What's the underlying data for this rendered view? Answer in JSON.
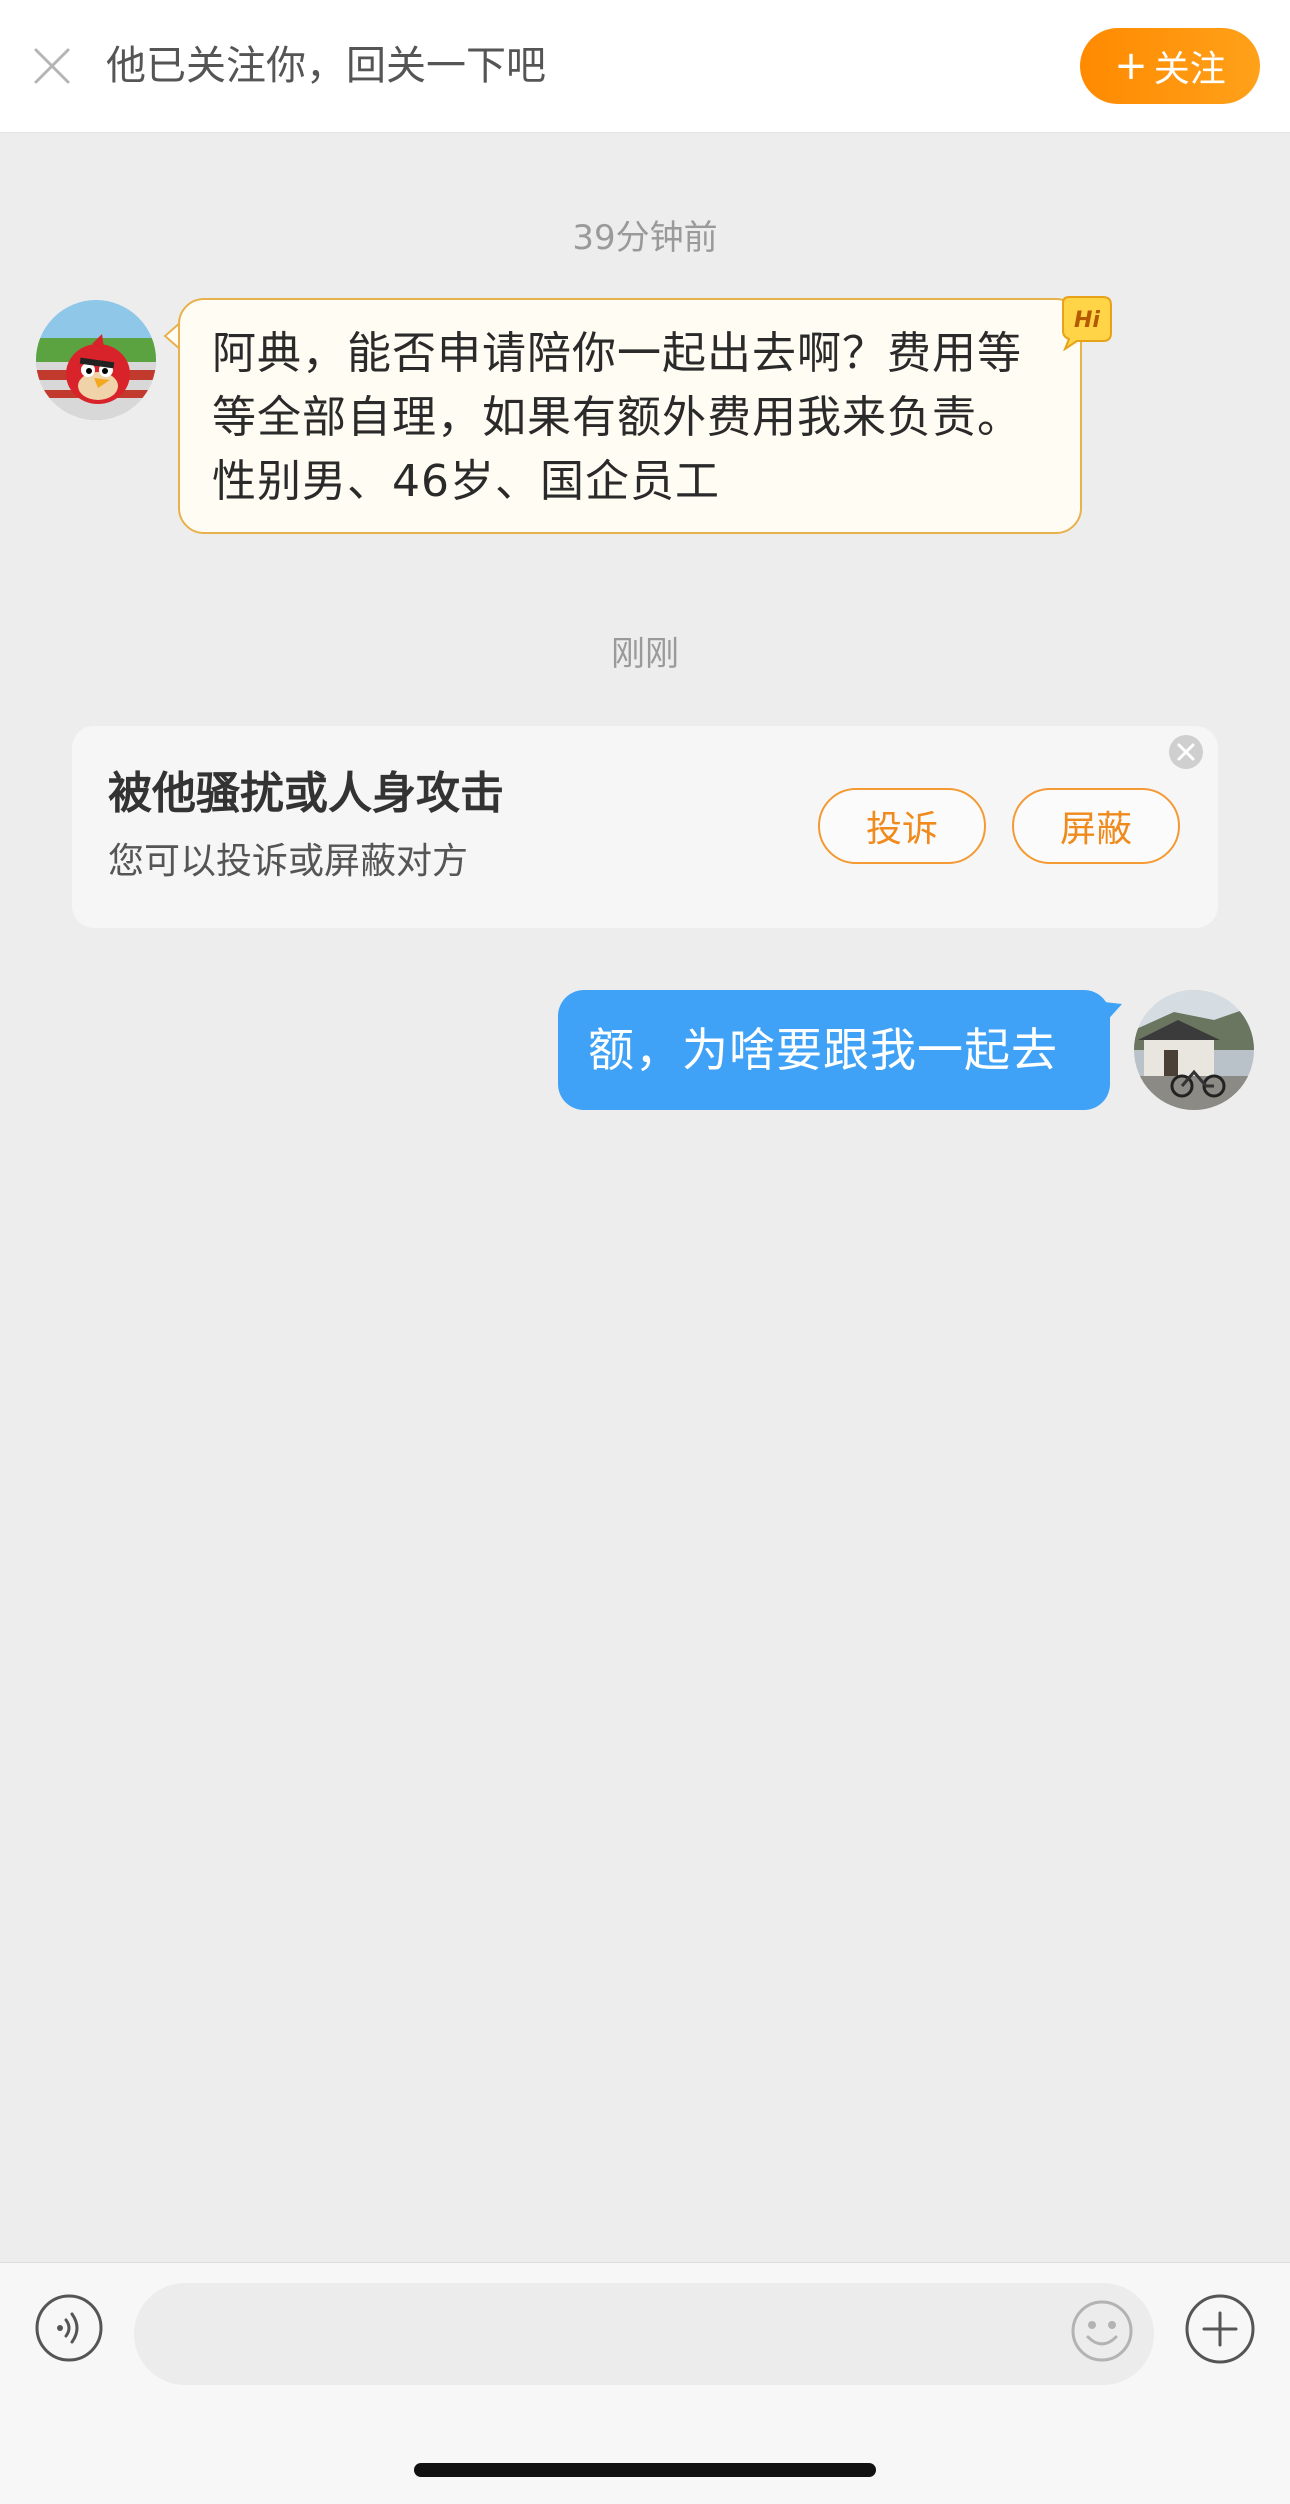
{
  "banner": {
    "text": "他已关注你，回关一下吧",
    "follow_label": "关注",
    "follow_plus": "+"
  },
  "conversation": {
    "timestamp_1": "39分钟前",
    "incoming_message": "阿典，能否申请陪你一起出去啊？费用等等全部自理，如果有额外费用我来负责。性别男、46岁、国企员工",
    "hi_badge": "Hi",
    "timestamp_2": "刚刚",
    "outgoing_message": "额，为啥要跟我一起去"
  },
  "report_card": {
    "title": "被他骚扰或人身攻击",
    "subtitle": "您可以投诉或屏蔽对方",
    "report_label": "投诉",
    "block_label": "屏蔽"
  },
  "input_bar": {
    "placeholder": ""
  },
  "colors": {
    "accent_orange": "#ff8a00",
    "outgoing_bubble": "#3fa2f6",
    "incoming_border": "#e8b14c",
    "background": "#ededed"
  },
  "icons": {
    "close": "close-icon",
    "hi": "hi-badge-icon",
    "voice": "voice-icon",
    "emoji": "emoji-icon",
    "plus": "plus-icon"
  }
}
